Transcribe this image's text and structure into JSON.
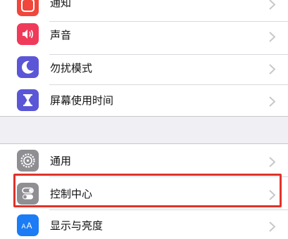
{
  "settings": {
    "group1": [
      {
        "label": "通知",
        "icon": "notifications-icon",
        "color": "#f0463c"
      },
      {
        "label": "声音",
        "icon": "speaker-icon",
        "color": "#f03a5a"
      },
      {
        "label": "勿扰模式",
        "icon": "moon-icon",
        "color": "#5b56d6"
      },
      {
        "label": "屏幕使用时间",
        "icon": "hourglass-icon",
        "color": "#5b56d6"
      }
    ],
    "group2": [
      {
        "label": "通用",
        "icon": "gear-icon",
        "color": "#8e8e93"
      },
      {
        "label": "控制中心",
        "icon": "toggles-icon",
        "color": "#8e8e93"
      },
      {
        "label": "显示与亮度",
        "icon": "text-size-icon",
        "color": "#1b7cf5"
      }
    ]
  },
  "highlight": {
    "color": "#e0322a",
    "target": "控制中心"
  }
}
